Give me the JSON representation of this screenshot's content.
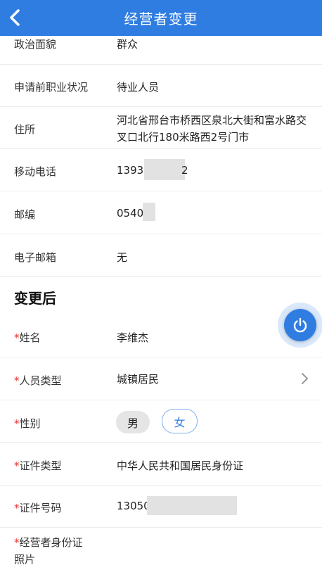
{
  "header": {
    "title": "经营者变更"
  },
  "top_rows": [
    {
      "label": "政治面貌",
      "value": "群众"
    },
    {
      "label": "申请前职业状况",
      "value": "待业人员"
    },
    {
      "label": "住所",
      "value_line1": "河北省邢台市桥西区泉北大街和富水路交",
      "value_line2": "叉口北行180米路西2号门市"
    },
    {
      "label": "移动电话",
      "value_start": "1393",
      "value_end": "2"
    },
    {
      "label": "邮编",
      "value": "0540"
    },
    {
      "label": "电子邮箱",
      "value": "无"
    }
  ],
  "section_after": "变更后",
  "after_rows": {
    "name": {
      "star": "*",
      "label": "姓名",
      "value": "李维杰"
    },
    "person_type": {
      "star": "*",
      "label": "人员类型",
      "value": "城镇居民"
    },
    "gender": {
      "star": "*",
      "label": "性别",
      "options": [
        "男",
        "女"
      ],
      "selected": "女"
    },
    "id_type": {
      "star": "*",
      "label": "证件类型",
      "value": "中华人民共和国居民身份证"
    },
    "id_number": {
      "star": "*",
      "label": "证件号码",
      "value": "13050"
    },
    "id_photo": {
      "star": "*",
      "label_line1": "经营者身份证",
      "label_line2": "照片"
    }
  },
  "colors": {
    "accent": "#2f7de1",
    "required_star": "#e5342f"
  },
  "icons": {
    "back": "chevron-left-icon",
    "arrow": "chevron-right-icon",
    "fab": "power-icon"
  }
}
